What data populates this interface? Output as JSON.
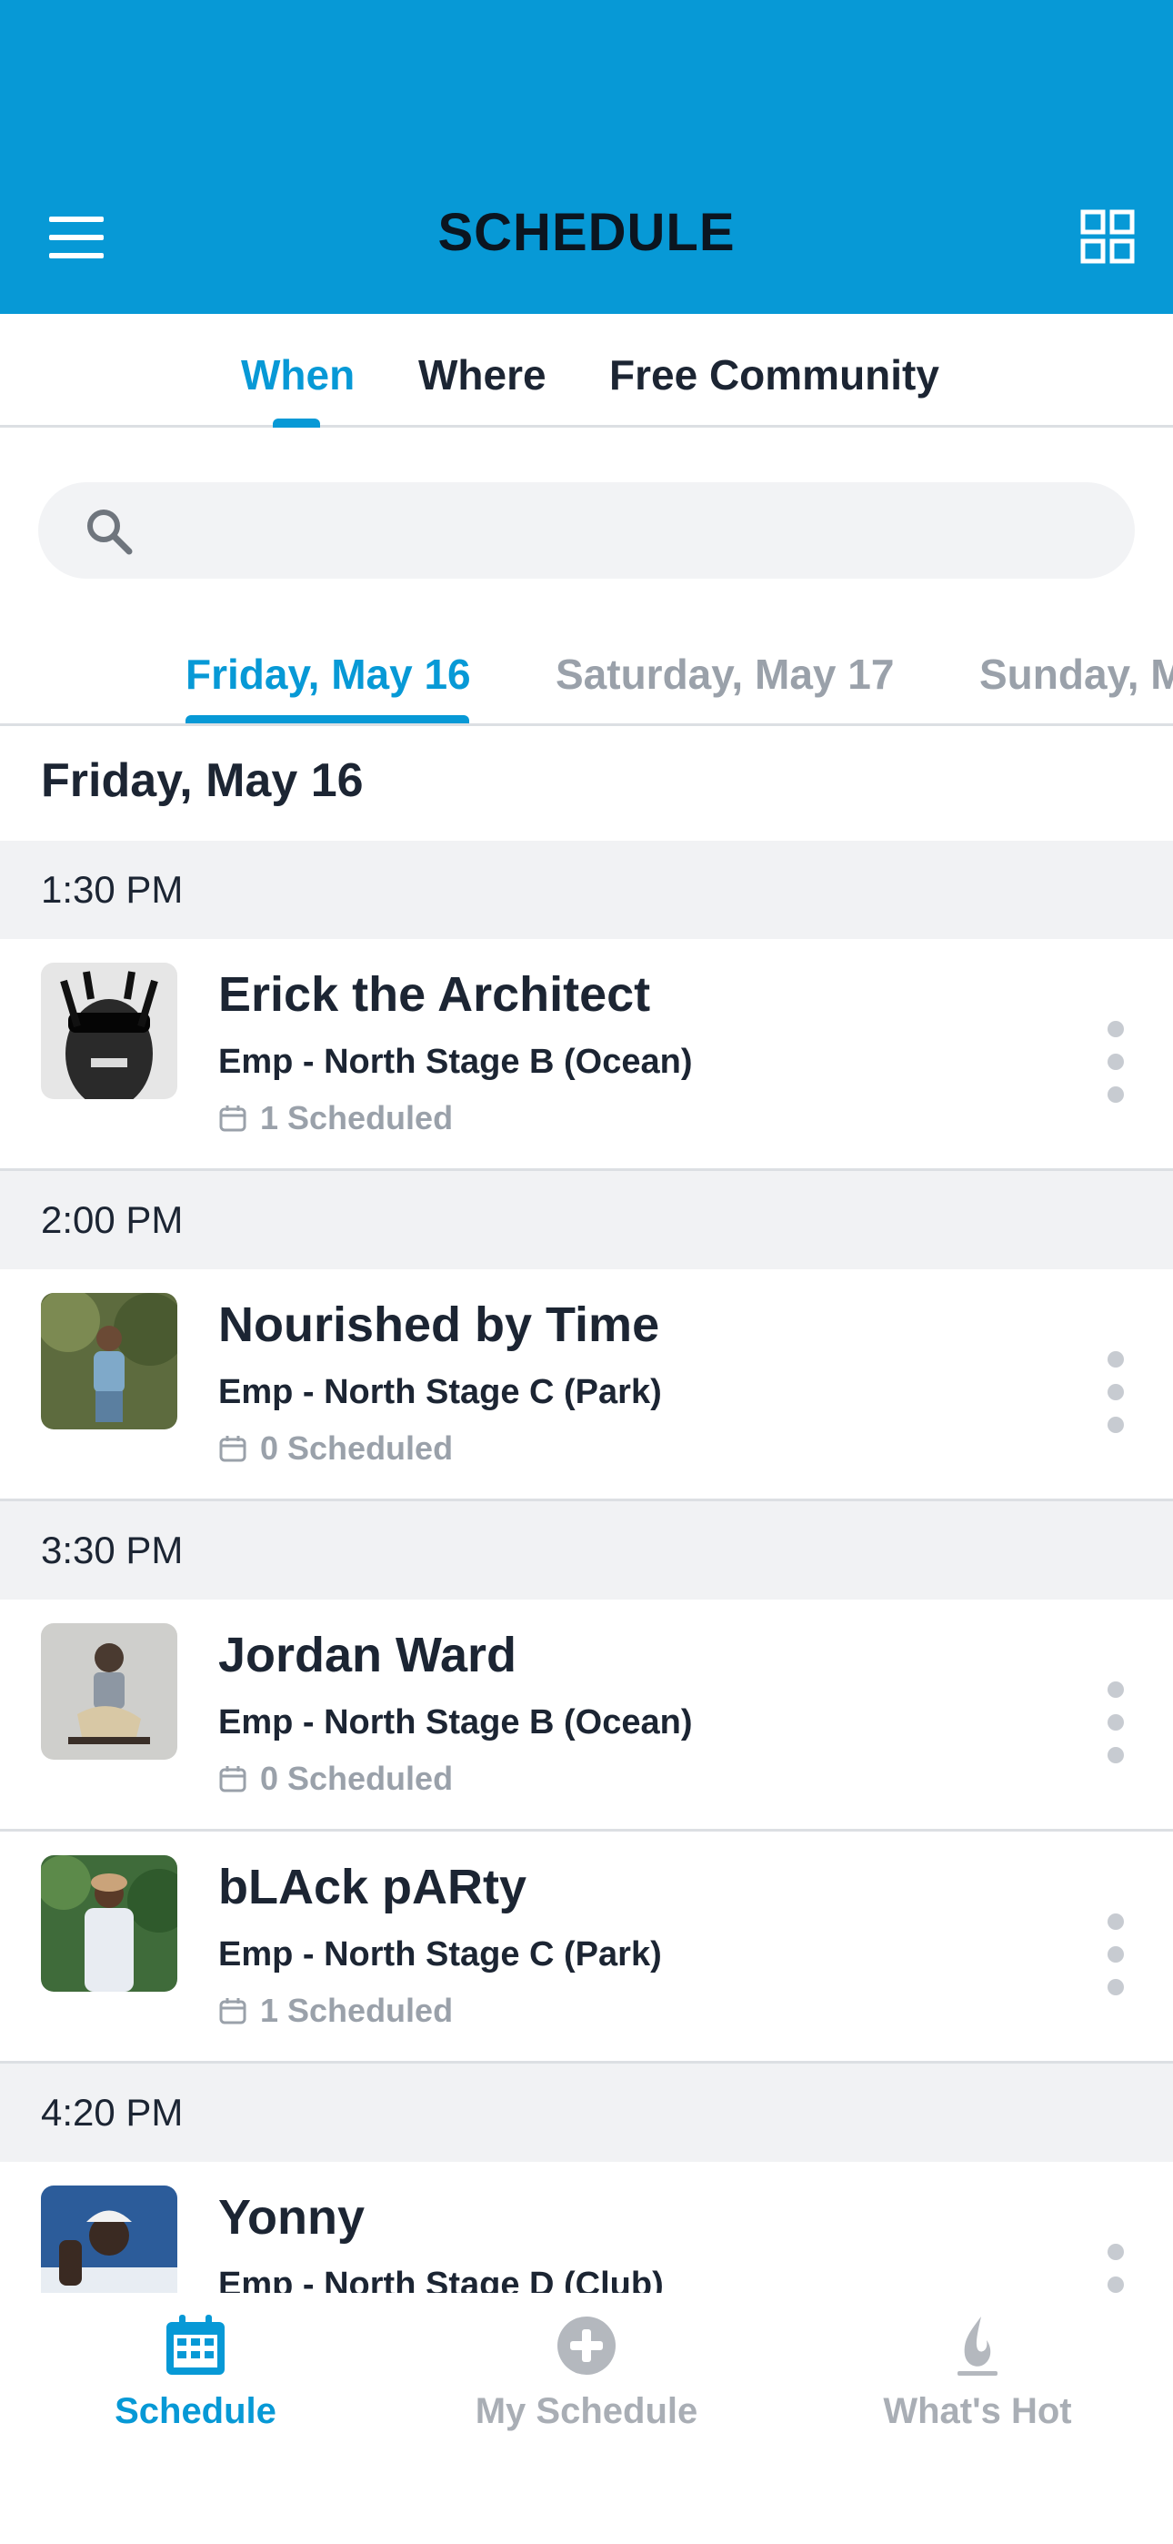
{
  "header": {
    "title": "SCHEDULE"
  },
  "top_tabs": [
    {
      "label": "When",
      "active": true
    },
    {
      "label": "Where",
      "active": false
    },
    {
      "label": "Free Community",
      "active": false
    }
  ],
  "search": {
    "placeholder": ""
  },
  "day_tabs": [
    {
      "label": "Friday, May 16",
      "active": true
    },
    {
      "label": "Saturday, May 17",
      "active": false
    },
    {
      "label": "Sunday, M",
      "active": false
    }
  ],
  "day_heading": "Friday, May 16",
  "slots": [
    {
      "time": "1:30 PM",
      "events": [
        {
          "title": "Erick the Architect",
          "stage": "Emp - North Stage B (Ocean)",
          "scheduled": "1 Scheduled"
        }
      ]
    },
    {
      "time": "2:00 PM",
      "events": [
        {
          "title": "Nourished by Time",
          "stage": "Emp - North Stage C (Park)",
          "scheduled": "0 Scheduled"
        }
      ]
    },
    {
      "time": "3:30 PM",
      "events": [
        {
          "title": "Jordan Ward",
          "stage": "Emp - North Stage B (Ocean)",
          "scheduled": "0 Scheduled"
        },
        {
          "title": "bLAck pARty",
          "stage": "Emp - North Stage C (Park)",
          "scheduled": "1 Scheduled"
        }
      ]
    },
    {
      "time": "4:20 PM",
      "events": [
        {
          "title": "Yonny",
          "stage": "Emp - North Stage D (Club)",
          "scheduled": ""
        }
      ]
    }
  ],
  "bottom_nav": [
    {
      "label": "Schedule",
      "icon": "calendar-icon",
      "active": true
    },
    {
      "label": "My Schedule",
      "icon": "plus-circle-icon",
      "active": false
    },
    {
      "label": "What's Hot",
      "icon": "flame-icon",
      "active": false
    }
  ],
  "colors": {
    "accent": "#0799d6",
    "muted": "#9aa1aa",
    "section_bg": "#f1f2f4"
  }
}
